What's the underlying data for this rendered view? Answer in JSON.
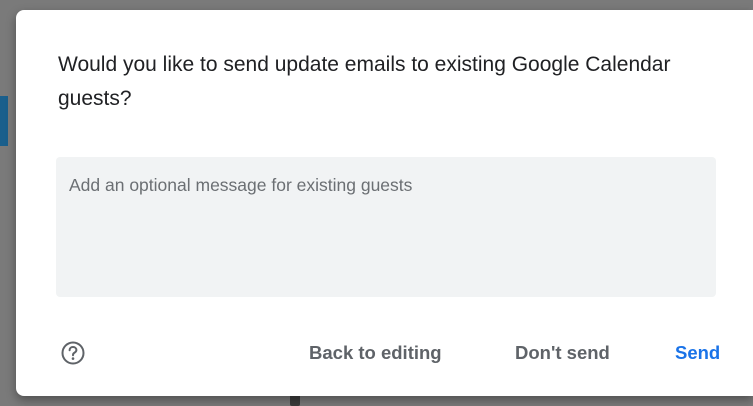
{
  "dialog": {
    "title": "Would you like to send update emails to existing Google Calendar guests?",
    "message_placeholder": "Add an optional message for existing guests",
    "message_value": "",
    "help_icon": "help-circle-icon",
    "buttons": {
      "back_to_editing": "Back to editing",
      "dont_send": "Don't send",
      "send": "Send"
    },
    "colors": {
      "primary": "#1a73e8",
      "secondary_text": "#5f6368",
      "input_bg": "#f1f3f4"
    }
  }
}
